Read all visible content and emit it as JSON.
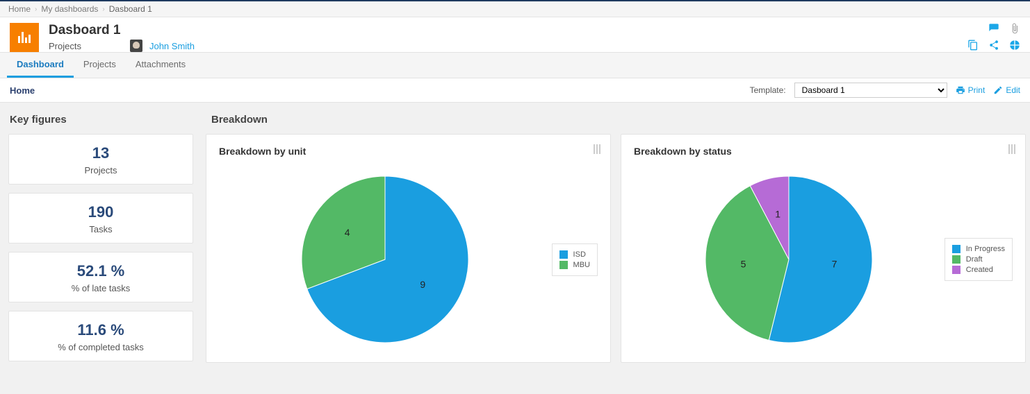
{
  "breadcrumb": {
    "items": [
      "Home",
      "My dashboards"
    ],
    "current": "Dasboard 1"
  },
  "header": {
    "title": "Dasboard 1",
    "subtitle": "Projects",
    "user": "John Smith"
  },
  "tabs": [
    {
      "label": "Dashboard",
      "active": true
    },
    {
      "label": "Projects",
      "active": false
    },
    {
      "label": "Attachments",
      "active": false
    }
  ],
  "subnav": {
    "home": "Home",
    "template_label": "Template:",
    "template_value": "Dasboard 1",
    "print": "Print",
    "edit": "Edit"
  },
  "kpi_title": "Key figures",
  "kpis": [
    {
      "value": "13",
      "label": "Projects"
    },
    {
      "value": "190",
      "label": "Tasks"
    },
    {
      "value": "52.1 %",
      "label": "% of late tasks"
    },
    {
      "value": "11.6 %",
      "label": "% of completed tasks"
    }
  ],
  "breakdown_title": "Breakdown",
  "colors": {
    "blue": "#1a9ee0",
    "green": "#53b966",
    "purple": "#b66bd6"
  },
  "chart_data": [
    {
      "type": "pie",
      "title": "Breakdown by unit",
      "series": [
        {
          "name": "ISD",
          "value": 9,
          "color": "#1a9ee0"
        },
        {
          "name": "MBU",
          "value": 4,
          "color": "#53b966"
        }
      ]
    },
    {
      "type": "pie",
      "title": "Breakdown by status",
      "series": [
        {
          "name": "In Progress",
          "value": 7,
          "color": "#1a9ee0"
        },
        {
          "name": "Draft",
          "value": 5,
          "color": "#53b966"
        },
        {
          "name": "Created",
          "value": 1,
          "color": "#b66bd6"
        }
      ]
    }
  ]
}
